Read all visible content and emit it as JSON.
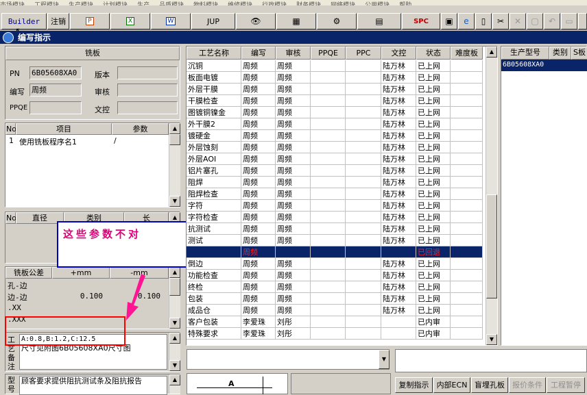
{
  "menu": [
    "市场模块",
    "工程模块",
    "生产模块",
    "计划模块",
    "生产",
    "品质模块",
    "物料模块",
    "维修模块",
    "行政模块",
    "财务模块",
    "网络模块",
    "公用模块",
    "帮助"
  ],
  "toolbar": {
    "builder": "Builder",
    "cancel": "注销",
    "jup": "JUP",
    "spc": "SPC"
  },
  "window_title": "编写指示",
  "board": {
    "header": "铣板",
    "pn_label": "PN",
    "pn_value": "6B05608XA0",
    "version_label": "版本",
    "version_value": "",
    "author_label": "编写",
    "author_value": "周频",
    "review_label": "审核",
    "review_value": "",
    "ppqe_label": "PPQE",
    "ppqe_value": "",
    "control_label": "文控",
    "control_value": ""
  },
  "items_table": {
    "headers": [
      "No",
      "项目",
      "参数"
    ],
    "rows": [
      {
        "no": "1",
        "item": "使用铣板程序名1",
        "param": "/"
      }
    ]
  },
  "diameter_table": {
    "headers": [
      "No",
      "直径",
      "类别",
      "长"
    ]
  },
  "tolerance": {
    "headers": [
      "铣板公差",
      "+mm",
      "-mm"
    ],
    "rows": [
      {
        "name": "孔-边",
        "plus": "",
        "minus": ""
      },
      {
        "name": "边-边",
        "plus": "0.100",
        "minus": "0.100"
      },
      {
        "name": ".XX",
        "plus": "",
        "minus": ""
      },
      {
        "name": ".XXX",
        "plus": "",
        "minus": ""
      }
    ]
  },
  "annotation": {
    "text": "这些参数不对"
  },
  "craft_label": "工艺备注",
  "craft_value_1": "A:0.8,B:1.2,C:12.5",
  "craft_value_2": "尺寸见附图6B05608XA0尺寸图",
  "model_label": "型号",
  "model_value": "顾客要求提供阻抗测试条及阻抗报告",
  "process_table": {
    "headers": [
      "工艺名称",
      "编写",
      "审核",
      "PPQE",
      "PPC",
      "文控",
      "状态",
      "难度板"
    ],
    "rows": [
      {
        "name": "沉铜",
        "author": "周频",
        "review": "周频",
        "ppqe": "",
        "ppc": "",
        "control": "陆万林",
        "status": "已上网"
      },
      {
        "name": "板面电镀",
        "author": "周频",
        "review": "周频",
        "ppqe": "",
        "ppc": "",
        "control": "陆万林",
        "status": "已上网"
      },
      {
        "name": "外层干膜",
        "author": "周频",
        "review": "周频",
        "ppqe": "",
        "ppc": "",
        "control": "陆万林",
        "status": "已上网"
      },
      {
        "name": "干膜检查",
        "author": "周频",
        "review": "周频",
        "ppqe": "",
        "ppc": "",
        "control": "陆万林",
        "status": "已上网"
      },
      {
        "name": "图镀铜镍金",
        "author": "周频",
        "review": "周频",
        "ppqe": "",
        "ppc": "",
        "control": "陆万林",
        "status": "已上网"
      },
      {
        "name": "外干膜2",
        "author": "周频",
        "review": "周频",
        "ppqe": "",
        "ppc": "",
        "control": "陆万林",
        "status": "已上网"
      },
      {
        "name": "镀硬金",
        "author": "周频",
        "review": "周频",
        "ppqe": "",
        "ppc": "",
        "control": "陆万林",
        "status": "已上网"
      },
      {
        "name": "外层蚀刻",
        "author": "周频",
        "review": "周频",
        "ppqe": "",
        "ppc": "",
        "control": "陆万林",
        "status": "已上网"
      },
      {
        "name": "外层AOI",
        "author": "周频",
        "review": "周频",
        "ppqe": "",
        "ppc": "",
        "control": "陆万林",
        "status": "已上网"
      },
      {
        "name": "铝片塞孔",
        "author": "周频",
        "review": "周频",
        "ppqe": "",
        "ppc": "",
        "control": "陆万林",
        "status": "已上网"
      },
      {
        "name": "阻焊",
        "author": "周频",
        "review": "周频",
        "ppqe": "",
        "ppc": "",
        "control": "陆万林",
        "status": "已上网"
      },
      {
        "name": "阻焊检查",
        "author": "周频",
        "review": "周频",
        "ppqe": "",
        "ppc": "",
        "control": "陆万林",
        "status": "已上网"
      },
      {
        "name": "字符",
        "author": "周频",
        "review": "周频",
        "ppqe": "",
        "ppc": "",
        "control": "陆万林",
        "status": "已上网"
      },
      {
        "name": "字符检查",
        "author": "周频",
        "review": "周频",
        "ppqe": "",
        "ppc": "",
        "control": "陆万林",
        "status": "已上网"
      },
      {
        "name": "抗测试",
        "author": "周频",
        "review": "周频",
        "ppqe": "",
        "ppc": "",
        "control": "陆万林",
        "status": "已上网"
      },
      {
        "name": "测试",
        "author": "周频",
        "review": "周频",
        "ppqe": "",
        "ppc": "",
        "control": "陆万林",
        "status": "已上网"
      },
      {
        "name": "",
        "author": "周频",
        "review": "",
        "ppqe": "",
        "ppc": "",
        "control": "",
        "status": "已回退",
        "selected": true
      },
      {
        "name": "倒边",
        "author": "周频",
        "review": "周频",
        "ppqe": "",
        "ppc": "",
        "control": "陆万林",
        "status": "已上网"
      },
      {
        "name": "功能检查",
        "author": "周频",
        "review": "周频",
        "ppqe": "",
        "ppc": "",
        "control": "陆万林",
        "status": "已上网"
      },
      {
        "name": "终检",
        "author": "周频",
        "review": "周频",
        "ppqe": "",
        "ppc": "",
        "control": "陆万林",
        "status": "已上网"
      },
      {
        "name": "包装",
        "author": "周频",
        "review": "周频",
        "ppqe": "",
        "ppc": "",
        "control": "陆万林",
        "status": "已上网"
      },
      {
        "name": "成品仓",
        "author": "周频",
        "review": "周频",
        "ppqe": "",
        "ppc": "",
        "control": "陆万林",
        "status": "已上网"
      },
      {
        "name": "客户包装",
        "author": "李爱珠",
        "review": "刘彤",
        "ppqe": "",
        "ppc": "",
        "control": "",
        "status": "已内审"
      },
      {
        "name": "特殊要求",
        "author": "李爱珠",
        "review": "刘彤",
        "ppqe": "",
        "ppc": "",
        "control": "",
        "status": "已内审"
      }
    ]
  },
  "model_table": {
    "headers": [
      "生产型号",
      "类别",
      "S板"
    ],
    "rows": [
      {
        "model": "6B05608XA0"
      }
    ]
  },
  "drawing_label": "A",
  "bottom_buttons": {
    "copy": "复制指示",
    "ecn": "内部ECN",
    "blind": "盲埋孔板",
    "quote": "报价条件",
    "pause": "工程暂停"
  },
  "colors": {
    "title_bar": "#0a246a",
    "selection": "#0a246a",
    "annotation_text": "#e0007a",
    "annotation_border": "#0000cc",
    "highlight_box": "#ff0000",
    "arrow": "#ff1493"
  }
}
